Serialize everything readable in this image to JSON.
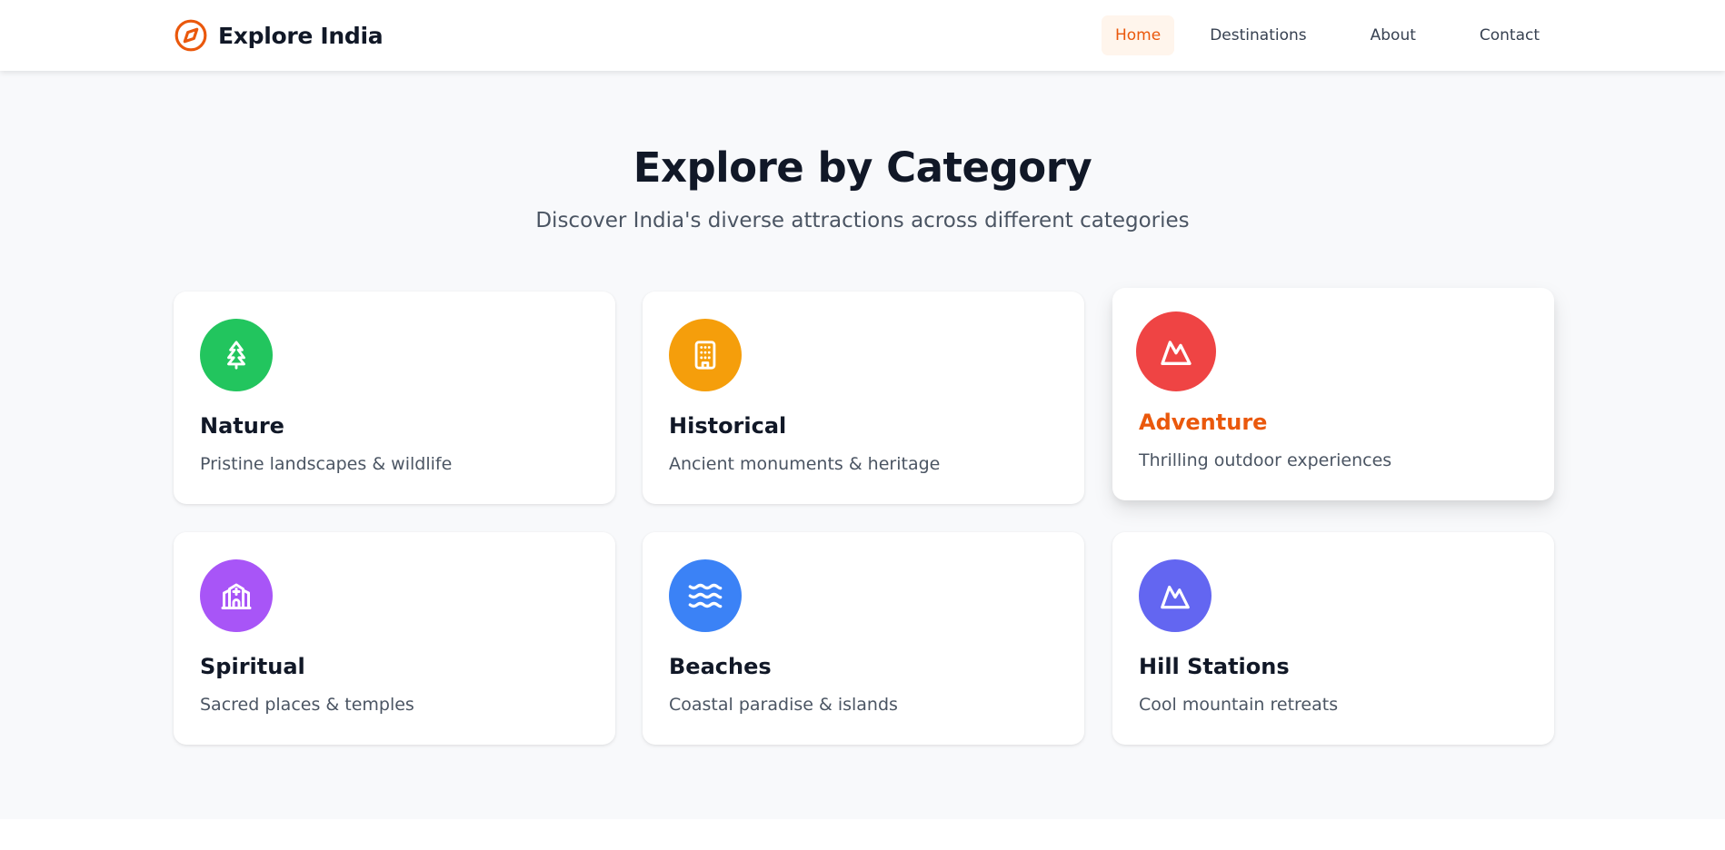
{
  "brand": {
    "name": "Explore India",
    "accent": "#ea580c"
  },
  "nav": {
    "items": [
      {
        "label": "Home",
        "active": true
      },
      {
        "label": "Destinations",
        "active": false
      },
      {
        "label": "About",
        "active": false
      },
      {
        "label": "Contact",
        "active": false
      }
    ]
  },
  "section": {
    "title": "Explore by Category",
    "subtitle": "Discover India's diverse attractions across different categories"
  },
  "categories": [
    {
      "title": "Nature",
      "description": "Pristine landscapes & wildlife",
      "icon": "tree-icon",
      "color": "#22c55e"
    },
    {
      "title": "Historical",
      "description": "Ancient monuments & heritage",
      "icon": "building-icon",
      "color": "#f59e0b"
    },
    {
      "title": "Adventure",
      "description": "Thrilling outdoor experiences",
      "icon": "mountain-icon",
      "color": "#ef4444",
      "hovered": true
    },
    {
      "title": "Spiritual",
      "description": "Sacred places & temples",
      "icon": "church-icon",
      "color": "#a855f7"
    },
    {
      "title": "Beaches",
      "description": "Coastal paradise & islands",
      "icon": "waves-icon",
      "color": "#3b82f6"
    },
    {
      "title": "Hill Stations",
      "description": "Cool mountain retreats",
      "icon": "mountain-icon",
      "color": "#6366f1"
    }
  ]
}
